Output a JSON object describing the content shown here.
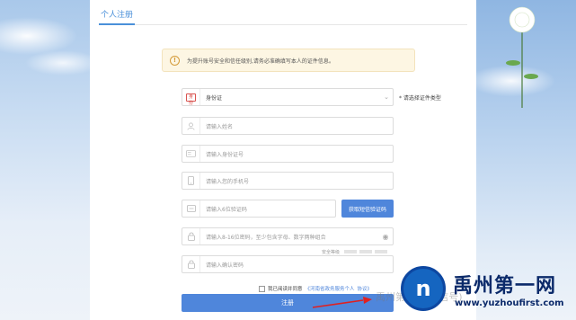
{
  "page": {
    "tab_label": "个人注册"
  },
  "notice": {
    "icon": "exclamation-icon",
    "text": "为提升账号安全和信任级别,请务必准确填写本人的证件信息。"
  },
  "form": {
    "id_type": {
      "badge": "身份",
      "value": "身份证",
      "hint": "* 请选择证件类型"
    },
    "name": {
      "placeholder": "请输入姓名"
    },
    "id_number": {
      "placeholder": "请输入身份证号"
    },
    "phone": {
      "placeholder": "请输入您的手机号"
    },
    "sms_code": {
      "placeholder": "请输入6位验证码",
      "button_label": "获取短信验证码"
    },
    "password": {
      "placeholder": "请输入8-16位密码，至少包含字母、数字两种组合"
    },
    "strength": {
      "label": "安全等级"
    },
    "confirm_password": {
      "placeholder": "请输入确认密码"
    },
    "agreement": {
      "prefix": "我已阅读并同意",
      "link": "《河南省政务服务个人",
      "suffix": "协议》"
    },
    "register_label": "注册"
  },
  "watermark": {
    "title": "禹州第一网",
    "url": "www.yuzhoufirst.com",
    "background_text": "禹州第一网(微信号)"
  },
  "colors": {
    "accent": "#4f86db",
    "notice_bg": "#fdf6e3",
    "badge_red": "#d9534f"
  }
}
